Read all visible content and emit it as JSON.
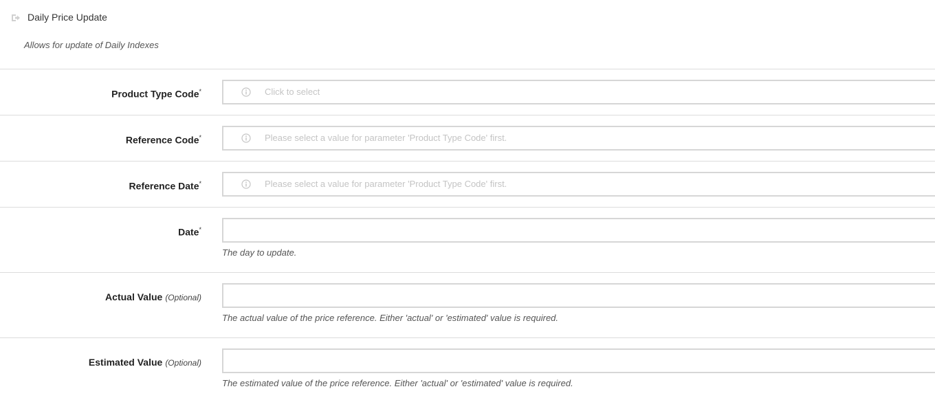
{
  "header": {
    "title": "Daily Price Update",
    "subtitle": "Allows for update of Daily Indexes"
  },
  "fields": [
    {
      "label": "Product Type Code",
      "required_marker": "*",
      "placeholder": "Click to select",
      "type": "select",
      "icon": "info-icon"
    },
    {
      "label": "Reference Code",
      "required_marker": "*",
      "placeholder": "Please select a value for parameter 'Product Type Code' first.",
      "type": "select",
      "icon": "info-icon"
    },
    {
      "label": "Reference Date",
      "required_marker": "*",
      "placeholder": "Please select a value for parameter 'Product Type Code' first.",
      "type": "select",
      "icon": "info-icon"
    },
    {
      "label": "Date",
      "required_marker": "*",
      "value": "",
      "help": "The day to update.",
      "type": "text"
    },
    {
      "label": "Actual Value",
      "optional_marker": "(Optional)",
      "value": "",
      "help": "The actual value of the price reference. Either 'actual' or 'estimated' value is required.",
      "type": "text"
    },
    {
      "label": "Estimated Value",
      "optional_marker": "(Optional)",
      "value": "",
      "help": "The estimated value of the price reference. Either 'actual' or 'estimated' value is required.",
      "type": "text"
    }
  ],
  "colors": {
    "border": "#d6d6d6",
    "divider": "#dcdcdc",
    "placeholder": "#c4c4c4"
  }
}
